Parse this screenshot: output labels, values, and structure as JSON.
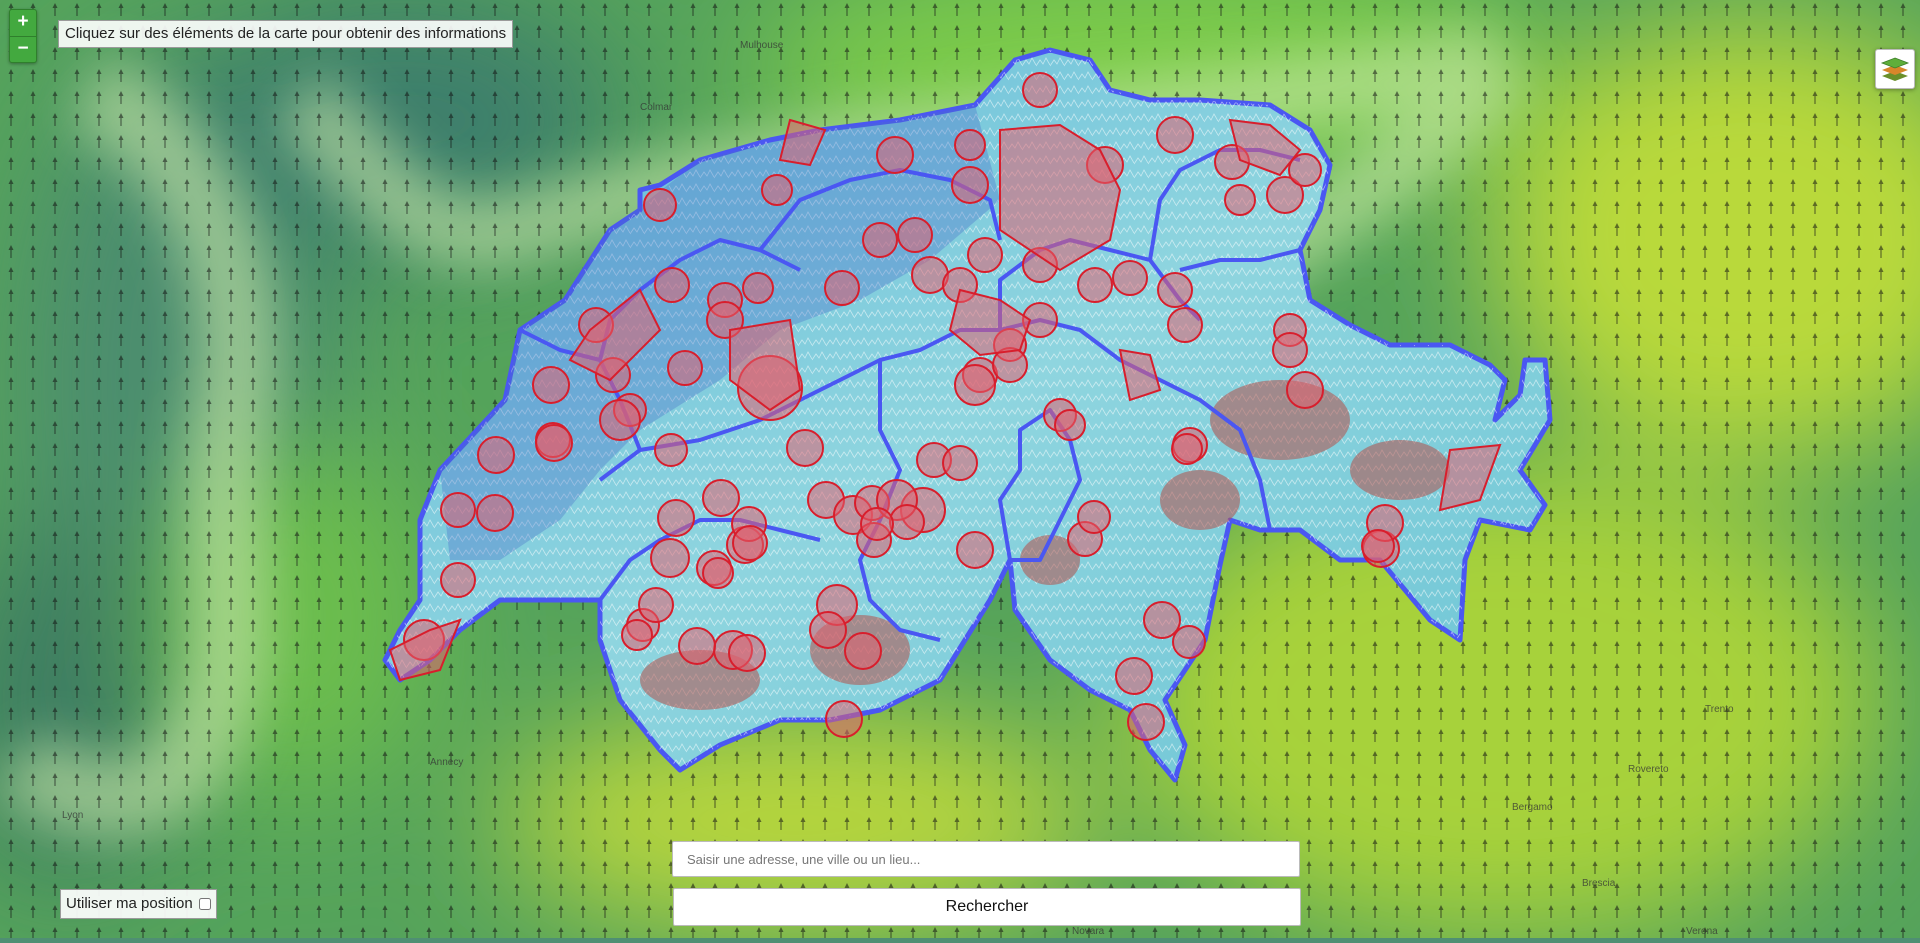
{
  "controls": {
    "zoom_in_label": "+",
    "zoom_out_label": "−",
    "info_text": "Cliquez sur des éléments de la carte pour obtenir des informations",
    "layers_icon": "layers-icon"
  },
  "search": {
    "placeholder": "Saisir une adresse, une ville ou un lieu...",
    "value": "",
    "button_label": "Rechercher"
  },
  "geolocation": {
    "label": "Utiliser ma position",
    "checked": false
  },
  "map_labels": [
    "Mulhouse",
    "Colmar",
    "Lyon",
    "Annecy",
    "Bergamo",
    "Brescia",
    "Verona",
    "Novara",
    "Trento",
    "Rovereto"
  ],
  "colors": {
    "zone_fill": "#e0606f",
    "zone_stroke": "#d81e2c",
    "border": "#4a57f2",
    "button_accent": "#43a93f"
  }
}
